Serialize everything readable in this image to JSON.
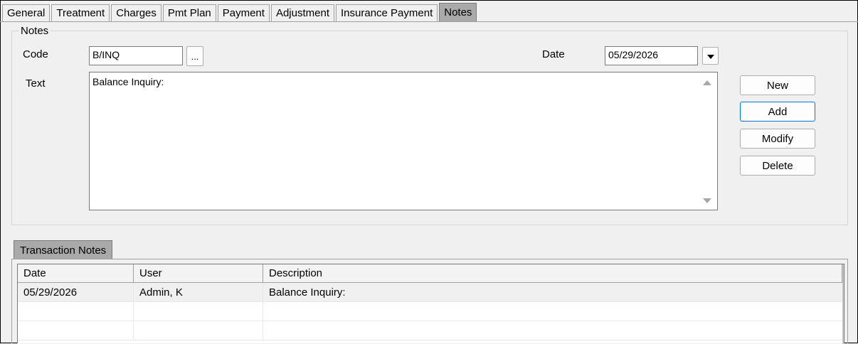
{
  "tabs": [
    {
      "label": "General"
    },
    {
      "label": "Treatment"
    },
    {
      "label": "Charges"
    },
    {
      "label": "Pmt Plan"
    },
    {
      "label": "Payment"
    },
    {
      "label": "Adjustment"
    },
    {
      "label": "Insurance Payment"
    },
    {
      "label": "Notes",
      "active": true
    }
  ],
  "notes_group": {
    "legend": "Notes",
    "code_label": "Code",
    "code_value": "B/INQ",
    "browse_label": "...",
    "date_label": "Date",
    "date_value": "05/29/2026",
    "text_label": "Text",
    "text_value": "Balance Inquiry:"
  },
  "actions": {
    "new": "New",
    "add": "Add",
    "modify": "Modify",
    "delete": "Delete"
  },
  "transaction_notes": {
    "tab_label": "Transaction Notes",
    "columns": [
      "Date",
      "User",
      "Description"
    ],
    "rows": [
      {
        "date": "05/29/2026",
        "user": "Admin, K",
        "description": "Balance Inquiry:"
      }
    ]
  },
  "colors": {
    "active_tab": "#a9a9a9",
    "focus_border": "#0078d7",
    "window_bg": "#f0f0f0"
  },
  "icons": {
    "date_dropdown": "chevron-down-icon",
    "scroll_up": "scroll-up-icon",
    "scroll_down": "scroll-down-icon"
  }
}
